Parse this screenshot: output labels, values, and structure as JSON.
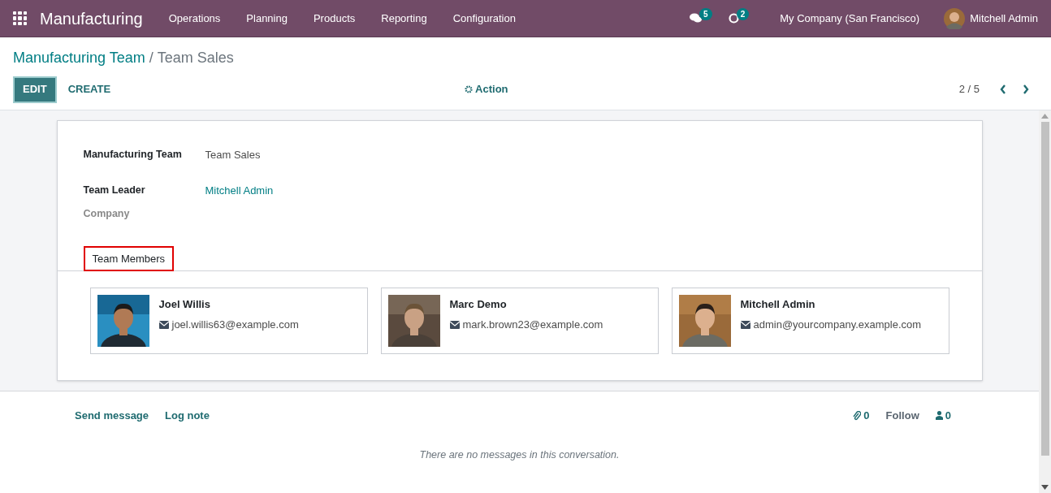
{
  "navbar": {
    "app_name": "Manufacturing",
    "menu": [
      "Operations",
      "Planning",
      "Products",
      "Reporting",
      "Configuration"
    ],
    "messages_count": "5",
    "activities_count": "2",
    "company": "My Company (San Francisco)",
    "user": "Mitchell Admin"
  },
  "breadcrumb": {
    "parent": "Manufacturing Team",
    "separator": "/",
    "current": "Team Sales"
  },
  "buttons": {
    "edit": "EDIT",
    "create": "CREATE",
    "action": "Action"
  },
  "pager": {
    "value": "2 / 5"
  },
  "form": {
    "fields": [
      {
        "label": "Manufacturing Team",
        "value": "Team Sales",
        "kind": "text"
      },
      {
        "label": "Team Leader",
        "value": "Mitchell Admin",
        "kind": "link"
      },
      {
        "label": "Company",
        "kind": "empty"
      }
    ],
    "tabs": [
      {
        "label": "Team Members",
        "selected": true,
        "highlighted": true
      }
    ],
    "members": [
      {
        "name": "Joel Willis",
        "email": "joel.willis63@example.com"
      },
      {
        "name": "Marc Demo",
        "email": "mark.brown23@example.com"
      },
      {
        "name": "Mitchell Admin",
        "email": "admin@yourcompany.example.com"
      }
    ]
  },
  "chatter": {
    "send_message": "Send message",
    "log_note": "Log note",
    "attachments_count": "0",
    "follow": "Follow",
    "followers_count": "0",
    "empty_message": "There are no messages in this conversation."
  }
}
